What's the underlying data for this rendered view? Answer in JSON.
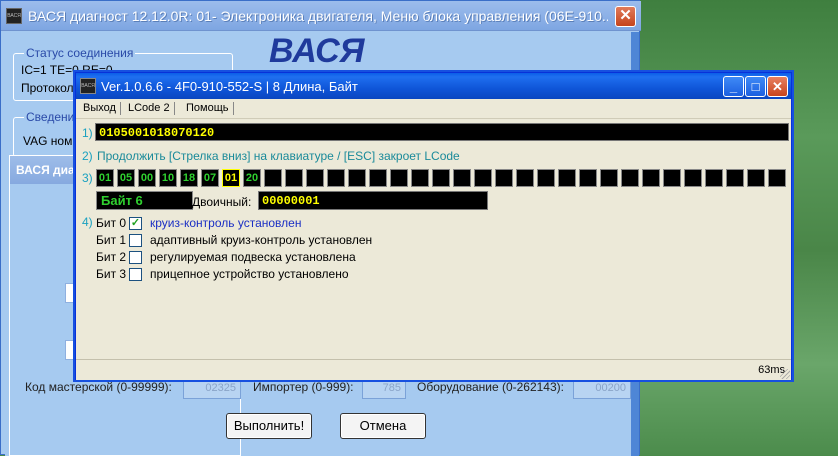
{
  "main_window": {
    "title": "ВАСЯ диагност 12.12.0R: 01- Электроника двигателя,  Меню блока управления (06E-910...",
    "logo": "ВАСЯ",
    "close_glyph": "✕",
    "connection_group": {
      "legend": "Статус соединения",
      "status": "IC=1  TE=0  RE=0",
      "protocol_label": "Протоколл"
    },
    "info_group": {
      "legend": "Сведени",
      "vag_label": "VAG ном"
    },
    "subwindow_title": "ВАСЯ диа",
    "bottom": {
      "workshop_label": "Код мастерской (0-99999):",
      "workshop_value": "02325",
      "importer_label": "Импортер (0-999):",
      "importer_value": "785",
      "equipment_label": "Оборудование (0-262143):",
      "equipment_value": "00200"
    },
    "execute_button": "Выполнить!",
    "cancel_button": "Отмена"
  },
  "dialog": {
    "title": "Ver.1.0.6.6 -    4F0-910-552-S | 8 Длина, Байт",
    "menu": [
      "Выход",
      "LCode 2",
      "Помощь"
    ],
    "step1": {
      "num": "1)",
      "lcode": "0105001018070120"
    },
    "step2": {
      "num": "2)",
      "hint": "Продолжить [Стрелка вниз] на клавиатуре / [ESC] закроет LCode"
    },
    "step3": {
      "num": "3)",
      "bytes": [
        "01",
        "05",
        "00",
        "10",
        "18",
        "07",
        "01",
        "20"
      ],
      "selected_index": 6,
      "byte_label": "Байт 6",
      "binary_label": "Двоичный:",
      "binary_value": "00000001"
    },
    "step4": {
      "num": "4)",
      "bits": [
        {
          "label": "Бит 0",
          "checked": true,
          "desc": "круиз-контроль установлен",
          "color": "#1b2fc4"
        },
        {
          "label": "Бит 1",
          "checked": false,
          "desc": "адаптивный круиз-контроль установлен"
        },
        {
          "label": "Бит 2",
          "checked": false,
          "desc": "регулируемая подвеска установлена"
        },
        {
          "label": "Бит 3",
          "checked": false,
          "desc": "прицепное устройство установлено"
        }
      ]
    },
    "status_time": "63ms"
  }
}
